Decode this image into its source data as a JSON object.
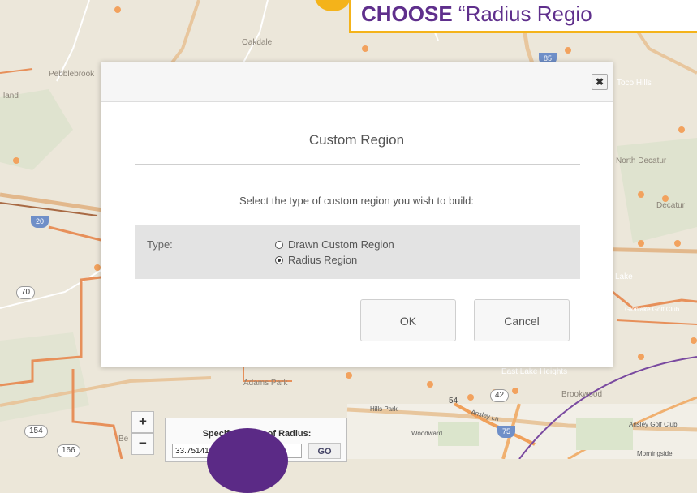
{
  "callout": {
    "verb": "CHOOSE",
    "text": " “Radius Regio"
  },
  "map": {
    "places": [
      "Oakdale",
      "Pebblebrook",
      "land",
      "Toco Hills",
      "North Decatur",
      "Decatur",
      "Lake",
      "Glenlake Golf Club",
      "East Lake Heights",
      "Brookwood",
      "Adams Park",
      "Hills Park",
      "Woodward",
      "Ansley Golf Club",
      "Morningside",
      "Be"
    ],
    "highways": [
      "85",
      "20",
      "70",
      "75",
      "42",
      "54",
      "154",
      "166"
    ],
    "street": "Ansley Ln"
  },
  "modal": {
    "close_label": "✖",
    "title": "Custom Region",
    "instruction": "Select the type of custom region you wish to build:",
    "type_label": "Type:",
    "options": [
      {
        "label": "Drawn Custom Region",
        "selected": false
      },
      {
        "label": "Radius Region",
        "selected": true
      }
    ],
    "ok_label": "OK",
    "cancel_label": "Cancel"
  },
  "map_controls": {
    "zoom_in": "+",
    "zoom_out": "−",
    "radius_title": "Specify Center of Radius:",
    "radius_value": "33.75141,-84.39259",
    "go_label": "GO"
  },
  "colors": {
    "accent": "#f4b31a",
    "brand_purple": "#5f2f8c",
    "boundary_orange": "#e7905a"
  }
}
